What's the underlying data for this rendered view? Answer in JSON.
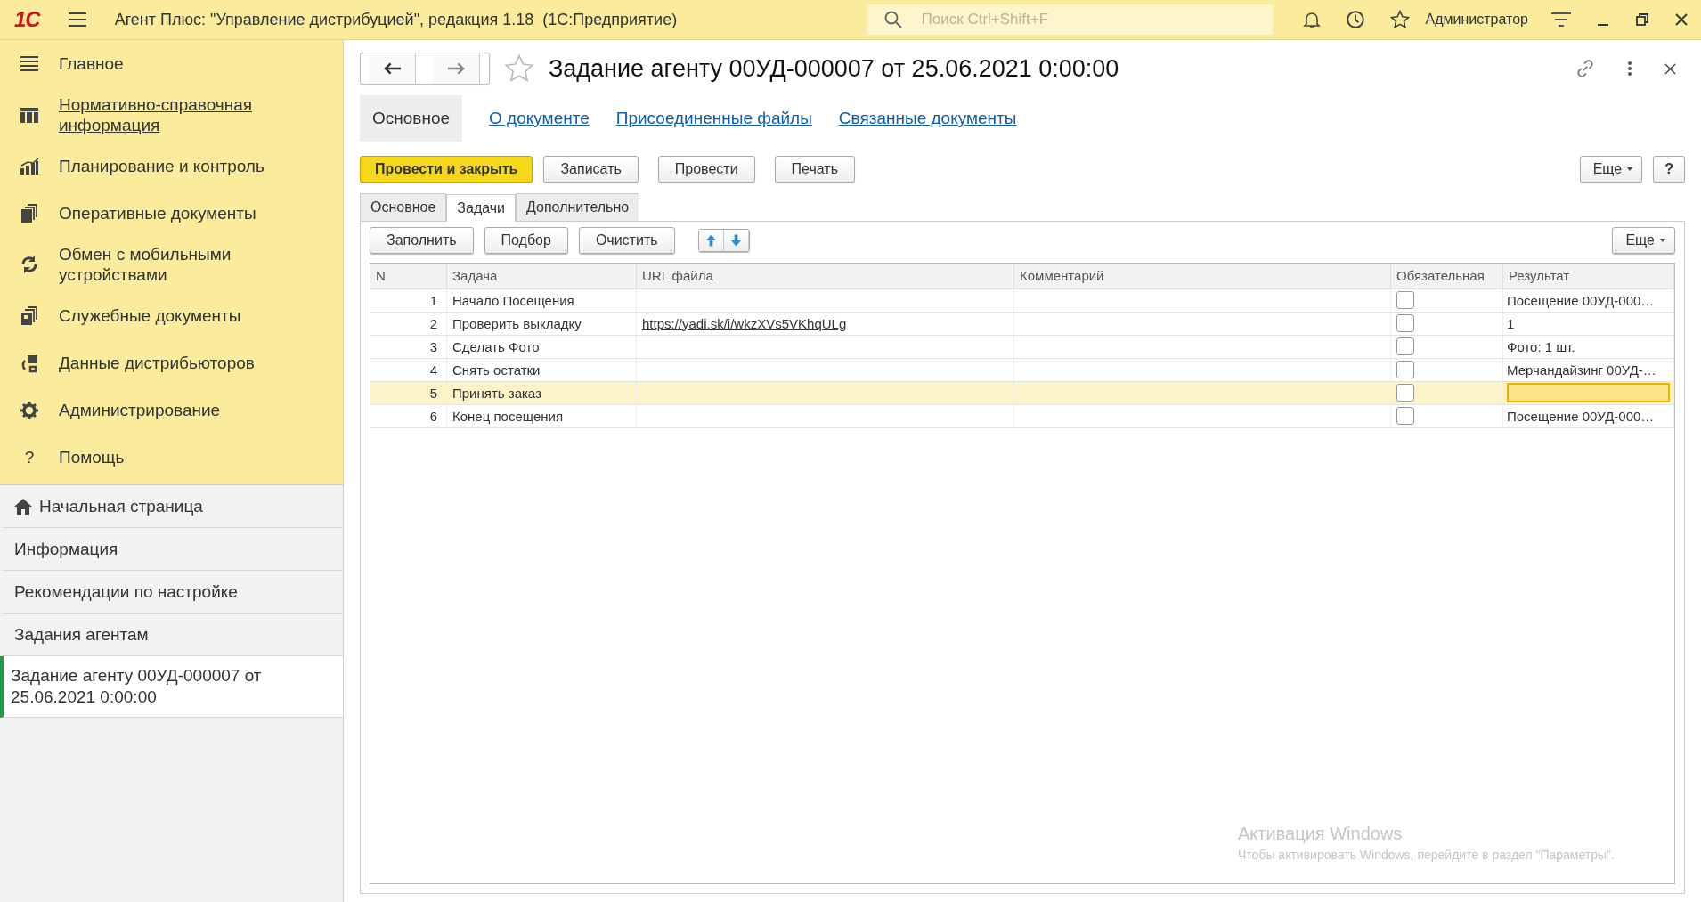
{
  "app_bar": {
    "logo": "1С",
    "title": "Агент Плюс: \"Управление дистрибуцией\", редакция 1.18  (1С:Предприятие)",
    "search": {
      "placeholder": "Поиск Ctrl+Shift+F"
    },
    "user": "Администратор"
  },
  "sidebar": {
    "sections": [
      {
        "kind": "menu",
        "label": "Главное",
        "hovered": false
      },
      {
        "kind": "grid",
        "label": "Нормативно-справочная информация",
        "hovered": true
      },
      {
        "kind": "chart",
        "label": "Планирование и контроль",
        "hovered": false
      },
      {
        "kind": "docs",
        "label": "Оперативные документы",
        "hovered": false
      },
      {
        "kind": "sync",
        "label": "Обмен с мобильными устройствами",
        "hovered": false
      },
      {
        "kind": "service",
        "label": "Служебные документы",
        "hovered": false
      },
      {
        "kind": "distrib",
        "label": "Данные дистрибьюторов",
        "hovered": false
      },
      {
        "kind": "gear",
        "label": "Администрирование",
        "hovered": false
      },
      {
        "kind": "help",
        "icon_text": "?",
        "label": "Помощь",
        "hovered": false
      }
    ],
    "open_windows": [
      {
        "kind": "home",
        "label": "Начальная страница",
        "selected": false
      },
      {
        "kind": "plain",
        "label": "Информация",
        "selected": false
      },
      {
        "kind": "plain",
        "label": "Рекомендации по настройке",
        "selected": false
      },
      {
        "kind": "plain",
        "label": "Задания агентам",
        "selected": false
      },
      {
        "kind": "plain",
        "label": "Задание агенту 00УД-000007 от 25.06.2021 0:00:00",
        "selected": true
      }
    ]
  },
  "form": {
    "title": "Задание агенту 00УД-000007 от 25.06.2021 0:00:00",
    "favorite": false,
    "tabs": [
      {
        "label": "Основное",
        "selected": true
      },
      {
        "label": "О документе",
        "selected": false
      },
      {
        "label": "Присоединенные файлы",
        "selected": false
      },
      {
        "label": "Связанные документы",
        "selected": false
      }
    ],
    "commands": [
      {
        "label": "Провести и закрыть",
        "kind": "primary"
      },
      {
        "label": "Записать",
        "kind": "normal"
      },
      {
        "label": "Провести",
        "kind": "normal"
      },
      {
        "label": "Печать",
        "kind": "normal"
      }
    ],
    "more_button": "Еще",
    "help_button": "?",
    "inner_tabs": [
      {
        "label": "Основное",
        "selected": false
      },
      {
        "label": "Задачи",
        "selected": true
      },
      {
        "label": "Дополнительно",
        "selected": false
      }
    ],
    "table_commands": [
      "Заполнить",
      "Подбор",
      "Очистить"
    ],
    "table_more_button": "Еще",
    "table": {
      "columns": [
        "N",
        "Задача",
        "URL файла",
        "Комментарий",
        "Обязательная",
        "Результат"
      ],
      "rows": [
        {
          "n": "1",
          "task": "Начало Посещения",
          "url": "",
          "comment": "",
          "required": false,
          "result": "Посещение 00УД-000…",
          "selected": false
        },
        {
          "n": "2",
          "task": "Проверить выкладку",
          "url": "https://yadi.sk/i/wkzXVs5VKhqULg",
          "comment": "",
          "required": false,
          "result": "1",
          "selected": false
        },
        {
          "n": "3",
          "task": "Сделать Фото",
          "url": "",
          "comment": "",
          "required": false,
          "result": "Фото: 1 шт.",
          "selected": false
        },
        {
          "n": "4",
          "task": "Снять остатки",
          "url": "",
          "comment": "",
          "required": false,
          "result": "Мерчандайзинг 00УД-…",
          "selected": false
        },
        {
          "n": "5",
          "task": "Принять заказ",
          "url": "",
          "comment": "",
          "required": false,
          "result": "",
          "selected": true
        },
        {
          "n": "6",
          "task": "Конец посещения",
          "url": "",
          "comment": "",
          "required": false,
          "result": "Посещение 00УД-000…",
          "selected": false
        }
      ]
    }
  },
  "windows_activation_notice": {
    "title": "Активация Windows",
    "text": "Чтобы активировать Windows, перейдите в раздел \"Параметры\"."
  }
}
